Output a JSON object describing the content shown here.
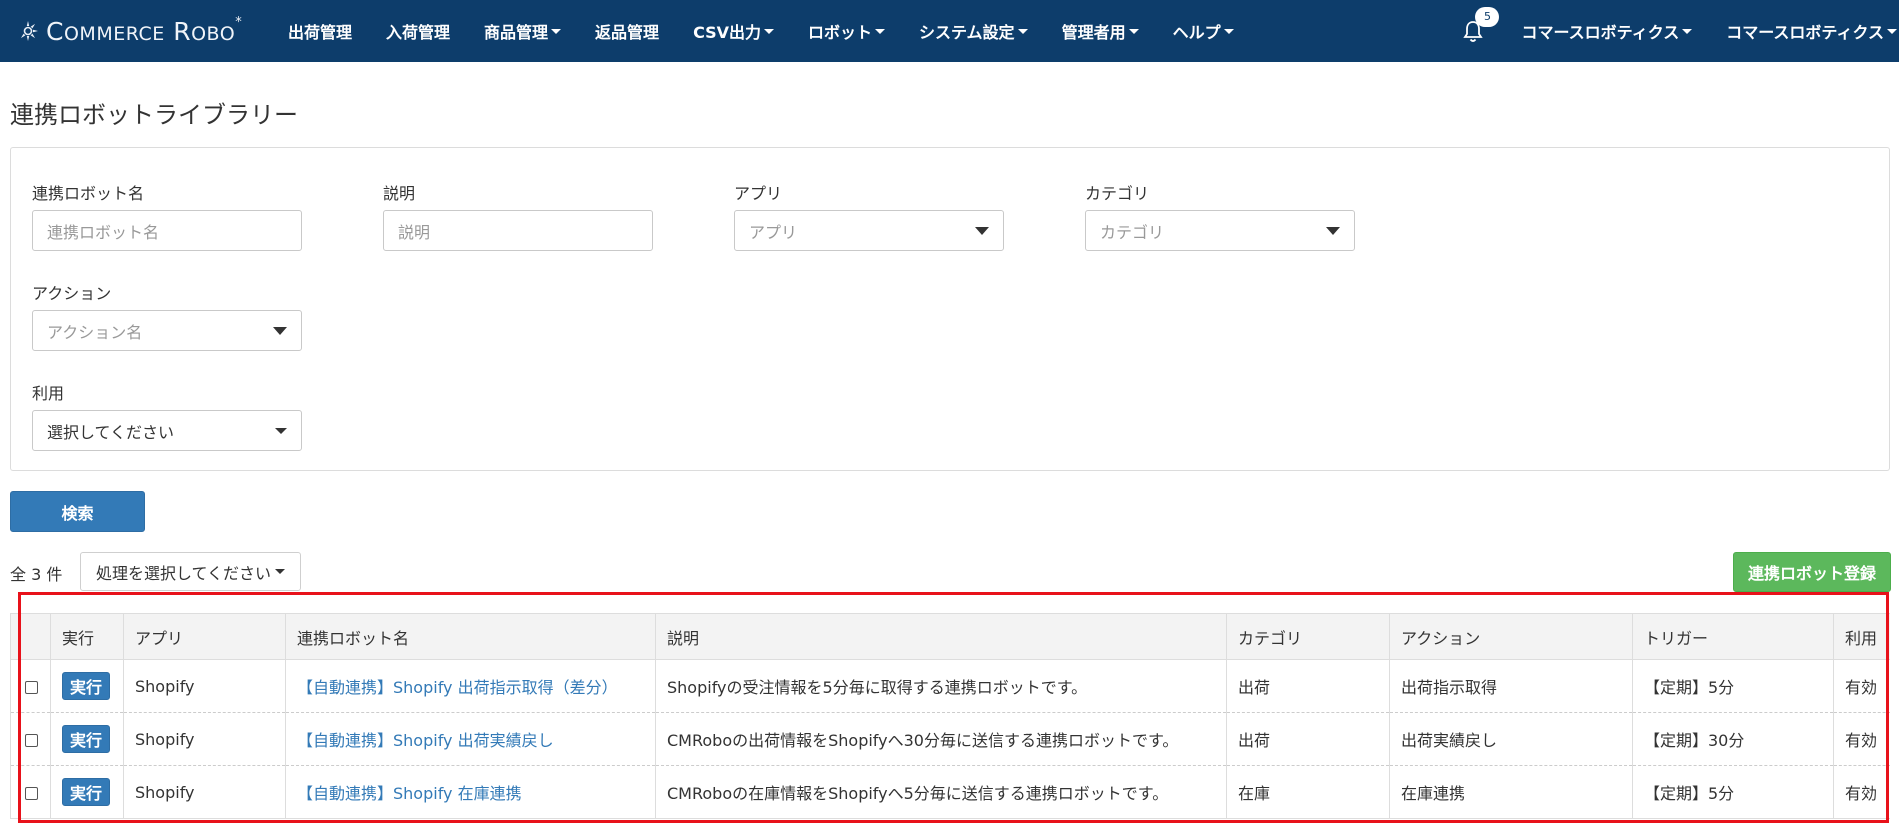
{
  "brand": {
    "text_main": "COMMERCE ROBO",
    "text_c": "C",
    "text_ommerce": "OMMERCE",
    "text_r": "R",
    "text_obo": "OBO",
    "text_mark": "*"
  },
  "nav": {
    "items": [
      {
        "label": "出荷管理",
        "dropdown": false
      },
      {
        "label": "入荷管理",
        "dropdown": false
      },
      {
        "label": "商品管理",
        "dropdown": true
      },
      {
        "label": "返品管理",
        "dropdown": false
      },
      {
        "label": "CSV出力",
        "dropdown": true
      },
      {
        "label": "ロボット",
        "dropdown": true
      },
      {
        "label": "システム設定",
        "dropdown": true
      },
      {
        "label": "管理者用",
        "dropdown": true
      },
      {
        "label": "ヘルプ",
        "dropdown": true
      }
    ],
    "notification_count": "5",
    "user_menu_1": "コマースロボティクス",
    "user_menu_2": "コマースロボティクス"
  },
  "page_title": "連携ロボットライブラリー",
  "filters": {
    "robot_name": {
      "label": "連携ロボット名",
      "placeholder": "連携ロボット名"
    },
    "description": {
      "label": "説明",
      "placeholder": "説明"
    },
    "app": {
      "label": "アプリ",
      "placeholder": "アプリ"
    },
    "category": {
      "label": "カテゴリ",
      "placeholder": "カテゴリ"
    },
    "action": {
      "label": "アクション",
      "placeholder": "アクション名"
    },
    "usage": {
      "label": "利用",
      "value": "選択してください"
    }
  },
  "search_button": "検索",
  "result_count": "全 3 件",
  "bulk_action": "処理を選択してください",
  "register_button": "連携ロボット登録",
  "table": {
    "headers": [
      "",
      "実行",
      "アプリ",
      "連携ロボット名",
      "説明",
      "カテゴリ",
      "アクション",
      "トリガー",
      "利用"
    ],
    "run_label": "実行",
    "rows": [
      {
        "app": "Shopify",
        "name": "【自動連携】Shopify 出荷指示取得（差分）",
        "description": "Shopifyの受注情報を5分毎に取得する連携ロボットです。",
        "category": "出荷",
        "action": "出荷指示取得",
        "trigger": "【定期】5分",
        "usage": "有効"
      },
      {
        "app": "Shopify",
        "name": "【自動連携】Shopify 出荷実績戻し",
        "description": "CMRoboの出荷情報をShopifyへ30分毎に送信する連携ロボットです。",
        "category": "出荷",
        "action": "出荷実績戻し",
        "trigger": "【定期】30分",
        "usage": "有効"
      },
      {
        "app": "Shopify",
        "name": "【自動連携】Shopify 在庫連携",
        "description": "CMRoboの在庫情報をShopifyへ5分毎に送信する連携ロボットです。",
        "category": "在庫",
        "action": "在庫連携",
        "trigger": "【定期】5分",
        "usage": "有効"
      }
    ]
  },
  "colors": {
    "navbar": "#0d3d6b",
    "primary": "#337ab7",
    "success": "#5cb85c",
    "highlight": "#e8111a"
  }
}
